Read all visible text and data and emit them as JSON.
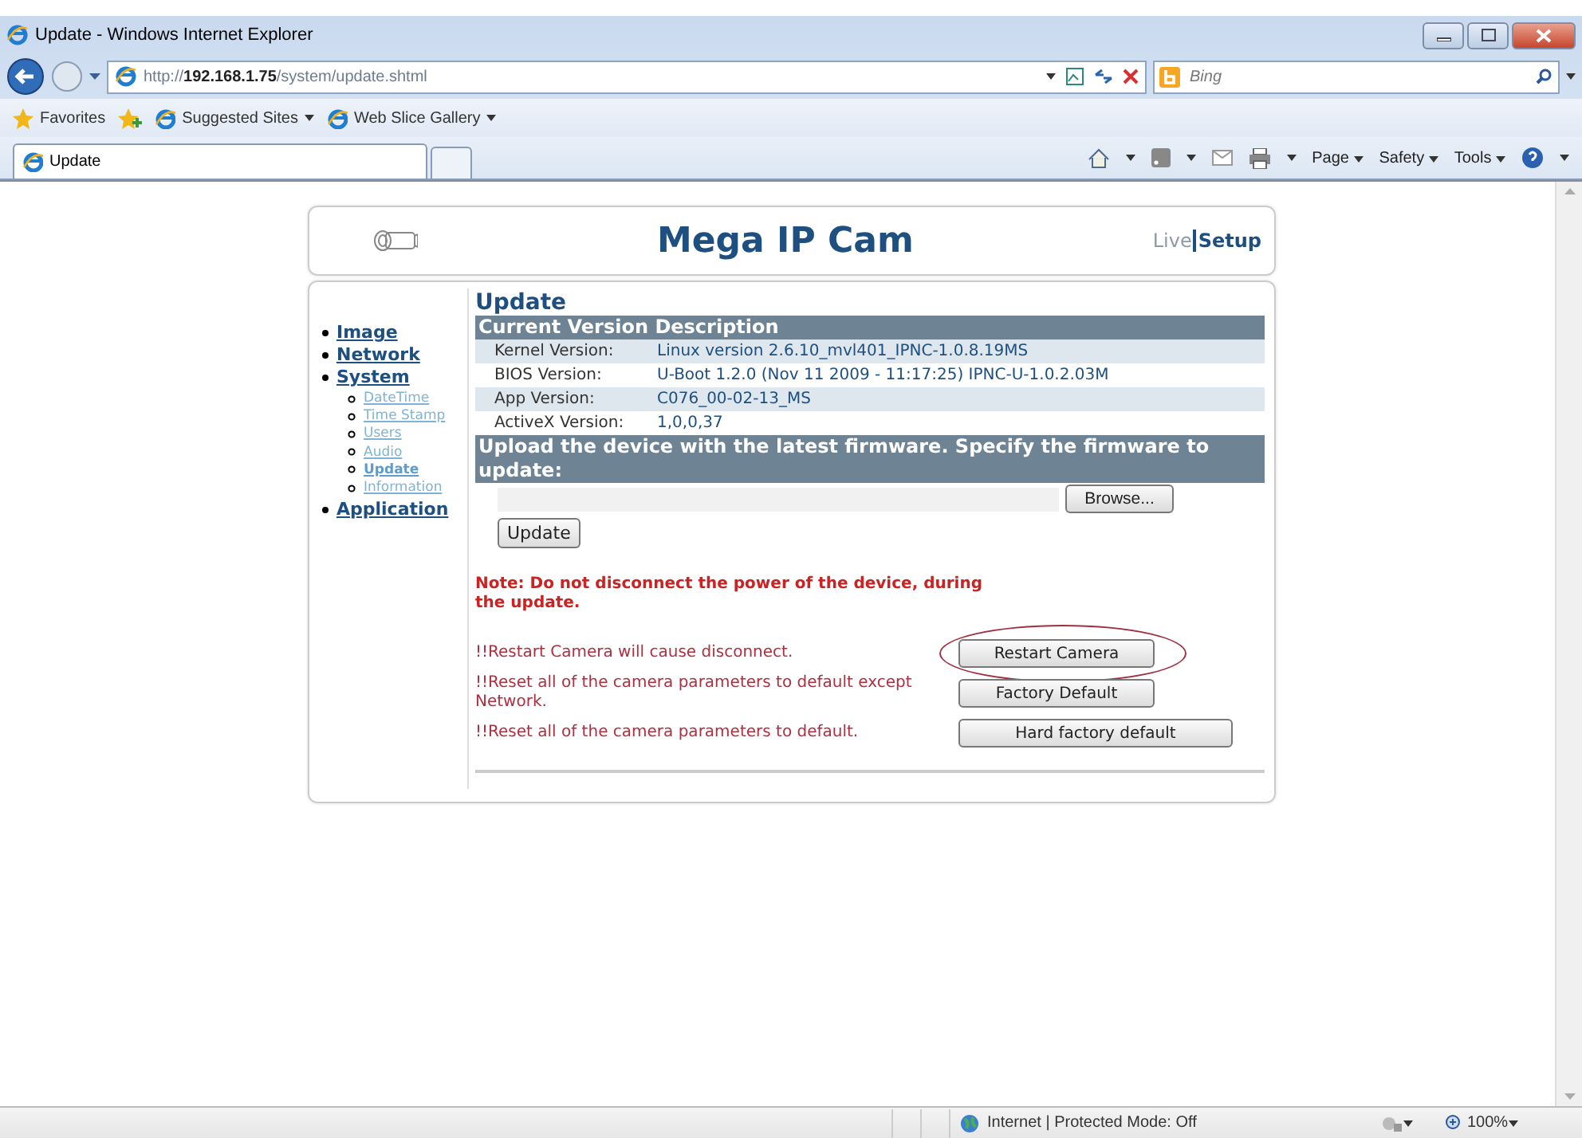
{
  "window": {
    "title": "Update - Windows Internet Explorer"
  },
  "address_bar": {
    "url": "http://**192.168.1.75**/system/update.shtml"
  },
  "search": {
    "placeholder": "Bing"
  },
  "favorites_bar": {
    "items": [
      "Favorites",
      "Suggested Sites",
      "Web Slice Gallery"
    ]
  },
  "tabs": [
    {
      "label": "Update",
      "selected": true
    }
  ],
  "command_bar": {
    "menus": [
      "Page",
      "Safety",
      "Tools"
    ]
  },
  "page": {
    "brand": "Mega IP Cam",
    "nav": [
      {
        "label": "Live",
        "selected": false
      },
      {
        "label": "Setup",
        "selected": true
      }
    ],
    "sidebar": [
      {
        "label": "Image",
        "selected": false
      },
      {
        "label": "Network",
        "selected": false
      },
      {
        "label": "System",
        "selected": false,
        "children": [
          {
            "label": "DateTime",
            "selected": false
          },
          {
            "label": "Time Stamp",
            "selected": false
          },
          {
            "label": "Users",
            "selected": false
          },
          {
            "label": "Audio",
            "selected": false
          },
          {
            "label": "Update",
            "selected": true
          },
          {
            "label": "Information",
            "selected": false
          }
        ]
      },
      {
        "label": "Application",
        "selected": false
      }
    ],
    "heading": "Update",
    "version_table": {
      "title": "Current Version Description",
      "rows": [
        {
          "label": "Kernel Version:",
          "value": "Linux version 2.6.10_mvl401_IPNC-1.0.8.19MS"
        },
        {
          "label": "BIOS Version:",
          "value": "U-Boot 1.2.0 (Nov 11 2009 - 11:17:25) IPNC-U-1.0.2.03M"
        },
        {
          "label": "App Version:",
          "value": "C076_00-02-13_MS"
        },
        {
          "label": "ActiveX Version:",
          "value": "1,0,0,37"
        }
      ]
    },
    "upload": {
      "title": "Upload the device with the latest firmware. Specify the firmware to update:",
      "browse_button": "Browse...",
      "update_button": "Update"
    },
    "note": "Note: Do not disconnect the power of the device, during the update.",
    "actions": [
      {
        "text": "!!Restart Camera will cause disconnect.",
        "button": "Restart Camera",
        "circled": true
      },
      {
        "text": "!!Reset all of the camera parameters to default except Network.",
        "button": "Factory Default",
        "circled": false
      },
      {
        "text": "!!Reset all of the camera parameters to default.",
        "button": "Hard factory default",
        "circled": false
      }
    ]
  },
  "status_bar": {
    "zone": "Internet | Protected Mode: Off",
    "zoom": "100%"
  }
}
